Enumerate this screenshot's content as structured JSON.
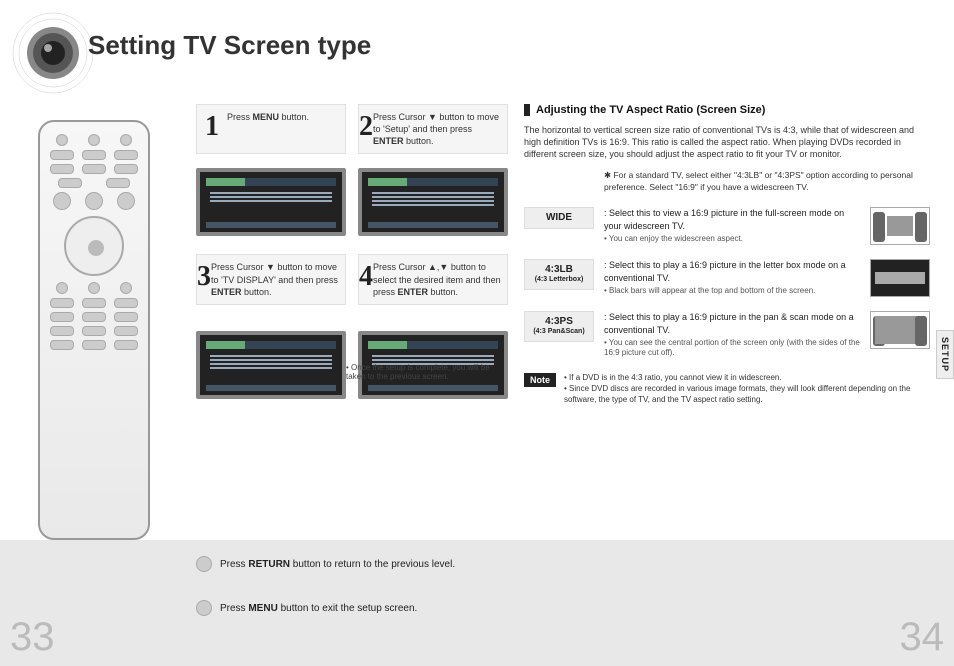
{
  "title": "Setting TV Screen type",
  "steps": {
    "s1": "Press <b>MENU</b> button.",
    "s2": "Press Cursor ▼ button to move to 'Setup' and then press <b>ENTER</b> button.",
    "s3": "Press Cursor ▼ button to move to 'TV DISPLAY' and then press <b>ENTER</b> button.",
    "s4": "Press Cursor ▲,▼ button to select the desired item and then press <b>ENTER</b> button."
  },
  "setup_note": "• Once the setup is complete, you will be taken to the previous screen.",
  "right": {
    "section_title": "Adjusting the TV Aspect Ratio (Screen Size)",
    "intro": "The horizontal to vertical screen size ratio of conventional TVs is 4:3, while that of widescreen and high definition TVs is 16:9. This ratio is called the aspect ratio. When playing DVDs recorded in different screen size, you should adjust the aspect ratio to fit your TV or monitor.",
    "hint": "✱ For a standard TV, select either \"4:3LB\" or \"4:3PS\" option according to personal preference. Select \"16:9\" if you have a widescreen TV.",
    "options": {
      "wide": {
        "label": "WIDE",
        "sub": "",
        "desc": ": Select this to view a 16:9 picture in the full-screen mode on your widescreen TV.",
        "bullet": "• You can enjoy the widescreen aspect."
      },
      "lb": {
        "label": "4:3LB",
        "sub": "(4:3 Letterbox)",
        "desc": ": Select this to play a 16:9 picture in the letter box mode on a conventional TV.",
        "bullet": "• Black bars will appear at the top and bottom of the screen."
      },
      "ps": {
        "label": "4:3PS",
        "sub": "(4:3 Pan&Scan)",
        "desc": ": Select this to play a 16:9 picture in the pan & scan mode on a conventional TV.",
        "bullet": "• You can see the central portion of the screen only (with the sides of the 16:9 picture cut off)."
      }
    },
    "note_label": "Note",
    "note_text": "• If a DVD is in the 4:3 ratio, you cannot view it in widescreen.\n• Since DVD discs are recorded in various image formats, they will look different depending on the software, the type of TV, and the TV aspect ratio setting."
  },
  "side_tab": "SETUP",
  "bottom": {
    "return_text": "Press <b>RETURN</b> button to return to the previous level.",
    "menu_text": "Press <b>MENU</b> button to exit the setup screen."
  },
  "pages": {
    "left": "33",
    "right": "34"
  }
}
